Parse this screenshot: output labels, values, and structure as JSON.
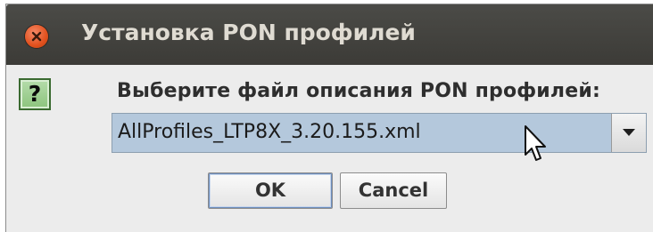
{
  "dialog": {
    "title": "Установка PON профилей",
    "prompt": "Выберите файл описания PON профилей:",
    "question_mark": "?",
    "icon": "question-icon",
    "file_select": {
      "selected_value": "AllProfiles_LTP8X_3.20.155.xml"
    },
    "ok_label": "OK",
    "cancel_label": "Cancel"
  },
  "colors": {
    "titlebar": "#3c3b37",
    "close_button": "#e2511e",
    "selection": "#b4c8dc",
    "dialog_background": "#ececec"
  }
}
